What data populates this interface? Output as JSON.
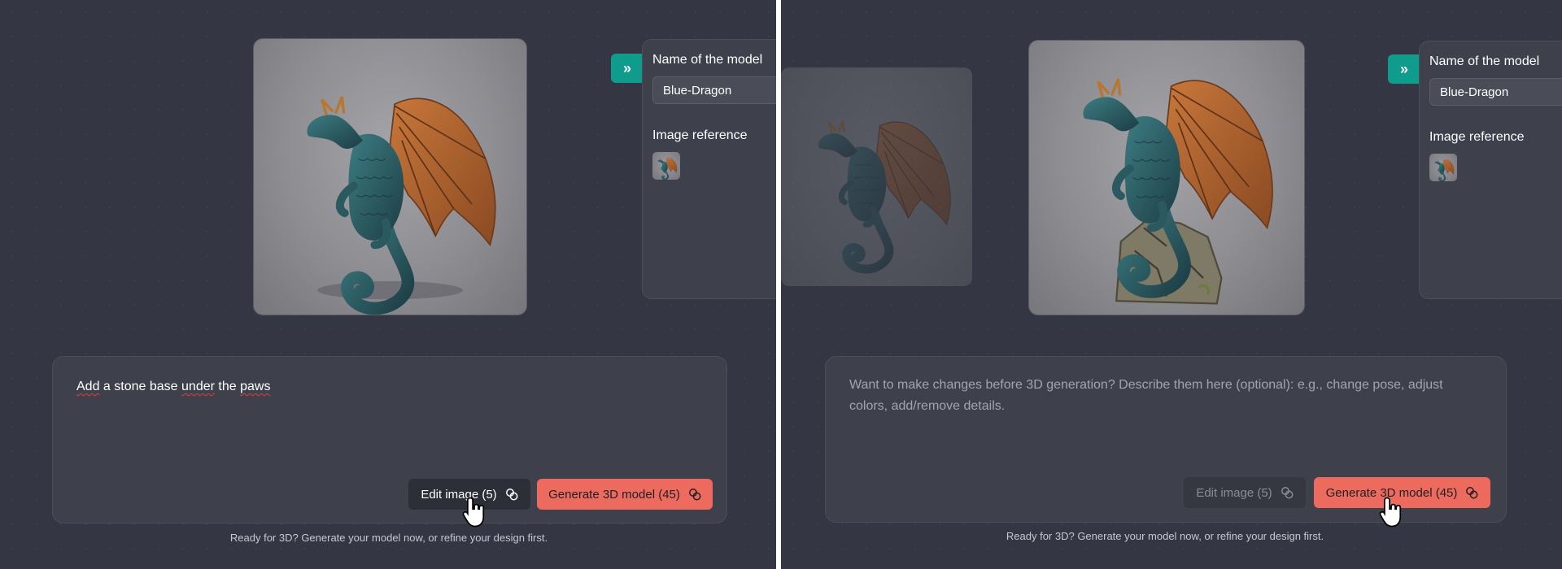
{
  "colors": {
    "background": "#343743",
    "panel": "#3e404c",
    "accent_teal": "#0f9c8c",
    "accent_coral": "#ec6b5e"
  },
  "left": {
    "side_panel": {
      "model_name_label": "Name of the model",
      "model_name_value": "Blue-Dragon",
      "image_reference_label": "Image reference",
      "expand_icon": "double-chevron-right-icon"
    },
    "prompt": {
      "words": [
        "Add",
        "a",
        "stone",
        "base",
        "under",
        "the",
        "paws"
      ]
    },
    "edit_button": "Edit image (5)",
    "generate_button": "Generate 3D model (45)",
    "caption": "Ready for 3D? Generate your model now, or refine your design first."
  },
  "right": {
    "side_panel": {
      "model_name_label": "Name of the model",
      "model_name_value": "Blue-Dragon",
      "image_reference_label": "Image reference",
      "expand_icon": "double-chevron-right-icon"
    },
    "prompt": {
      "placeholder": "Want to make changes before 3D generation? Describe them here (optional): e.g., change pose, adjust colors, add/remove details."
    },
    "edit_button": "Edit image (5)",
    "generate_button": "Generate 3D model (45)",
    "caption": "Ready for 3D? Generate your model now, or refine your design first."
  }
}
